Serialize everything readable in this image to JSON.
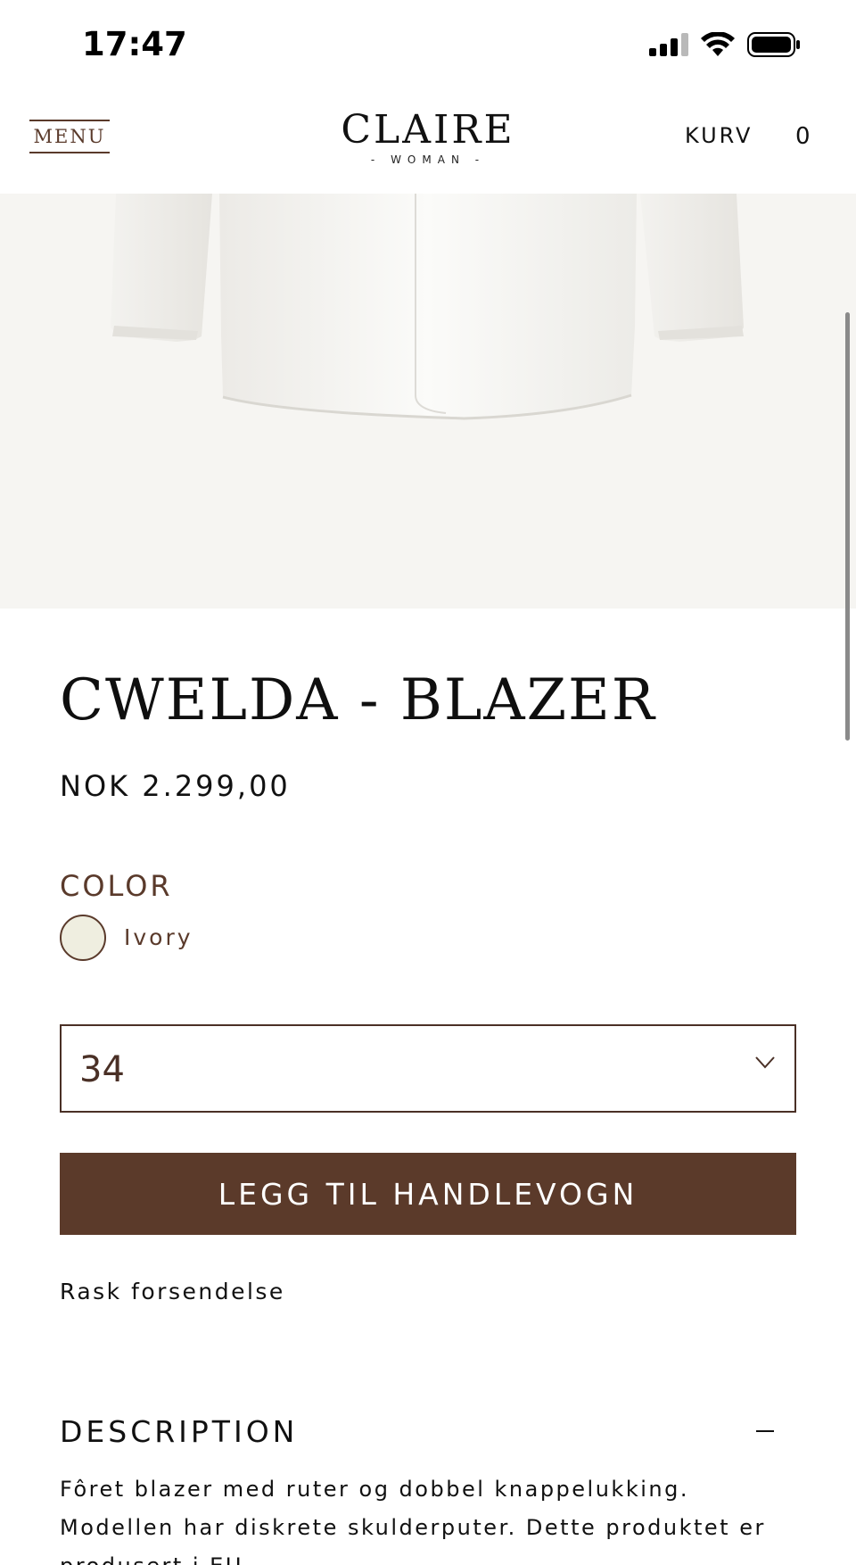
{
  "status_bar": {
    "time": "17:47"
  },
  "header": {
    "menu_label": "MENU",
    "logo_main": "CLAIRE",
    "logo_sub": "- WOMAN -",
    "cart_label": "KURV",
    "cart_count": "0"
  },
  "product": {
    "title": "CWELDA - BLAZER",
    "price": "NOK 2.299,00",
    "color_heading": "COLOR",
    "color_name": "Ivory",
    "color_hex": "#efeee0",
    "size_value": "34",
    "add_to_cart_label": "LEGG TIL HANDLEVOGN",
    "shipping_note": "Rask forsendelse"
  },
  "description": {
    "heading": "DESCRIPTION",
    "text": "Fôret blazer med ruter og dobbel knappelukking. Modellen har diskrete skulderputer. Dette produktet er produsert i EU."
  },
  "colors": {
    "brand_brown": "#5b3a2a",
    "image_background": "#f6f5f2"
  }
}
